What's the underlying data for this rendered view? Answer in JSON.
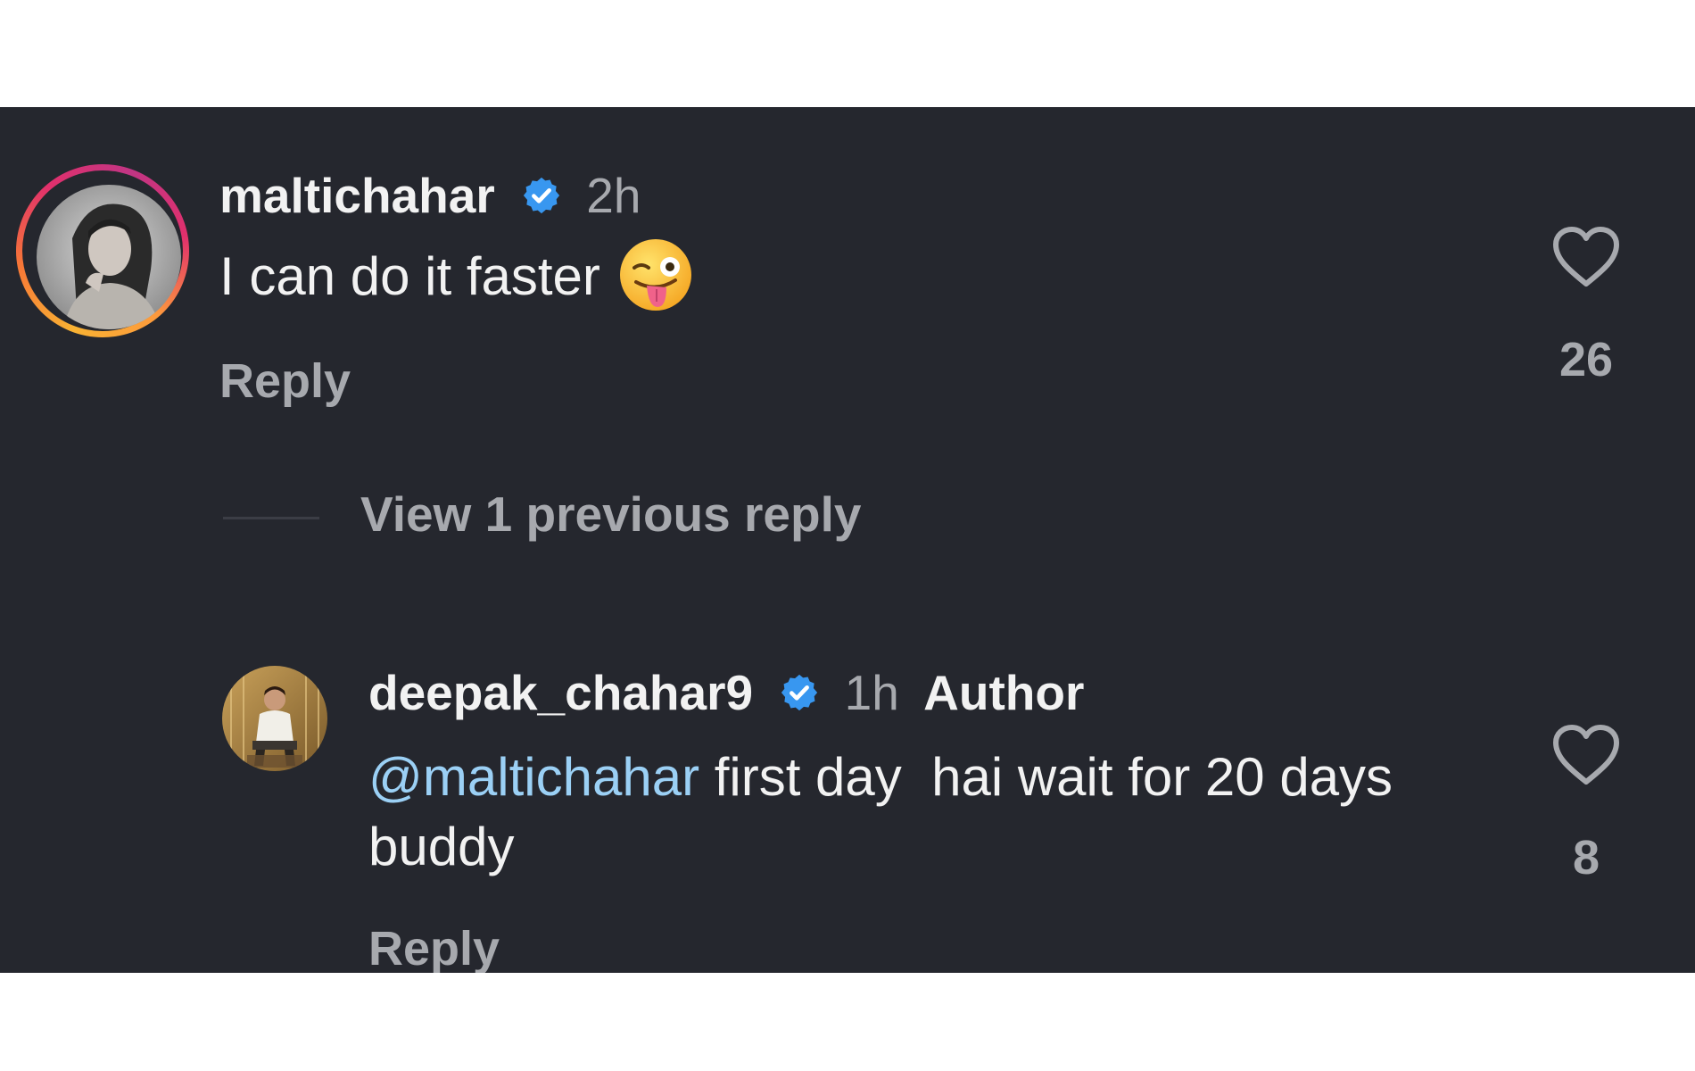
{
  "comment": {
    "username": "maltichahar",
    "verified": true,
    "time": "2h",
    "text": "I can do it faster",
    "emoji": "winking-face-with-tongue",
    "reply_label": "Reply",
    "like_count": "26"
  },
  "thread": {
    "view_replies_label": "View 1 previous reply"
  },
  "reply": {
    "username": "deepak_chahar9",
    "verified": true,
    "time": "1h",
    "author_tag": "Author",
    "mention": "@maltichahar",
    "text": " first day  hai wait for 20 days buddy",
    "reply_label": "Reply",
    "like_count": "8"
  },
  "colors": {
    "background": "#25272e",
    "text": "#f2f2f2",
    "muted": "#a7a9ae",
    "verified_badge": "#3897f0",
    "mention": "#9bd0f5"
  }
}
